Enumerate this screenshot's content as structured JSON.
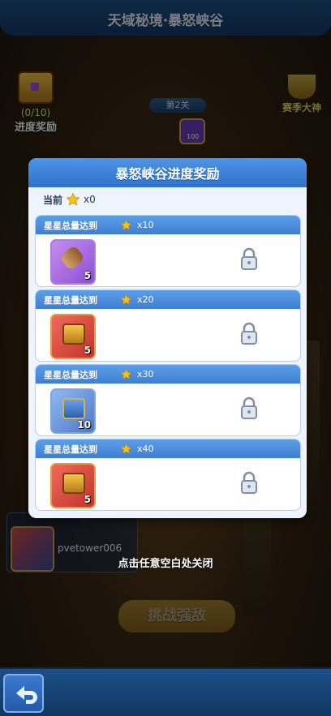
{
  "header": {
    "title": "天域秘境·暴怒峡谷"
  },
  "background": {
    "progress_count": "(0/10)",
    "progress_label": "进度奖励",
    "season_label": "赛季大神",
    "level_label": "第2关",
    "level_value": "100",
    "challenge_label": "挑战强敌",
    "player_name": "pvetower006"
  },
  "modal": {
    "title": "暴怒峡谷进度奖励",
    "current_label": "当前",
    "current_multiplier": "x0",
    "rewards": [
      {
        "label": "星星总量达到",
        "multiplier": "x10",
        "item": "scroll",
        "count": "5"
      },
      {
        "label": "星星总量达到",
        "multiplier": "x20",
        "item": "red-chest",
        "count": "5"
      },
      {
        "label": "星星总量达到",
        "multiplier": "x30",
        "item": "blue-chest",
        "count": "10"
      },
      {
        "label": "星星总量达到",
        "multiplier": "x40",
        "item": "red-chest",
        "count": "5"
      }
    ]
  },
  "hint": "点击任意空白处关闭",
  "icons": {
    "star": "star-icon",
    "lock": "lock-icon",
    "back": "back-arrow-icon"
  }
}
